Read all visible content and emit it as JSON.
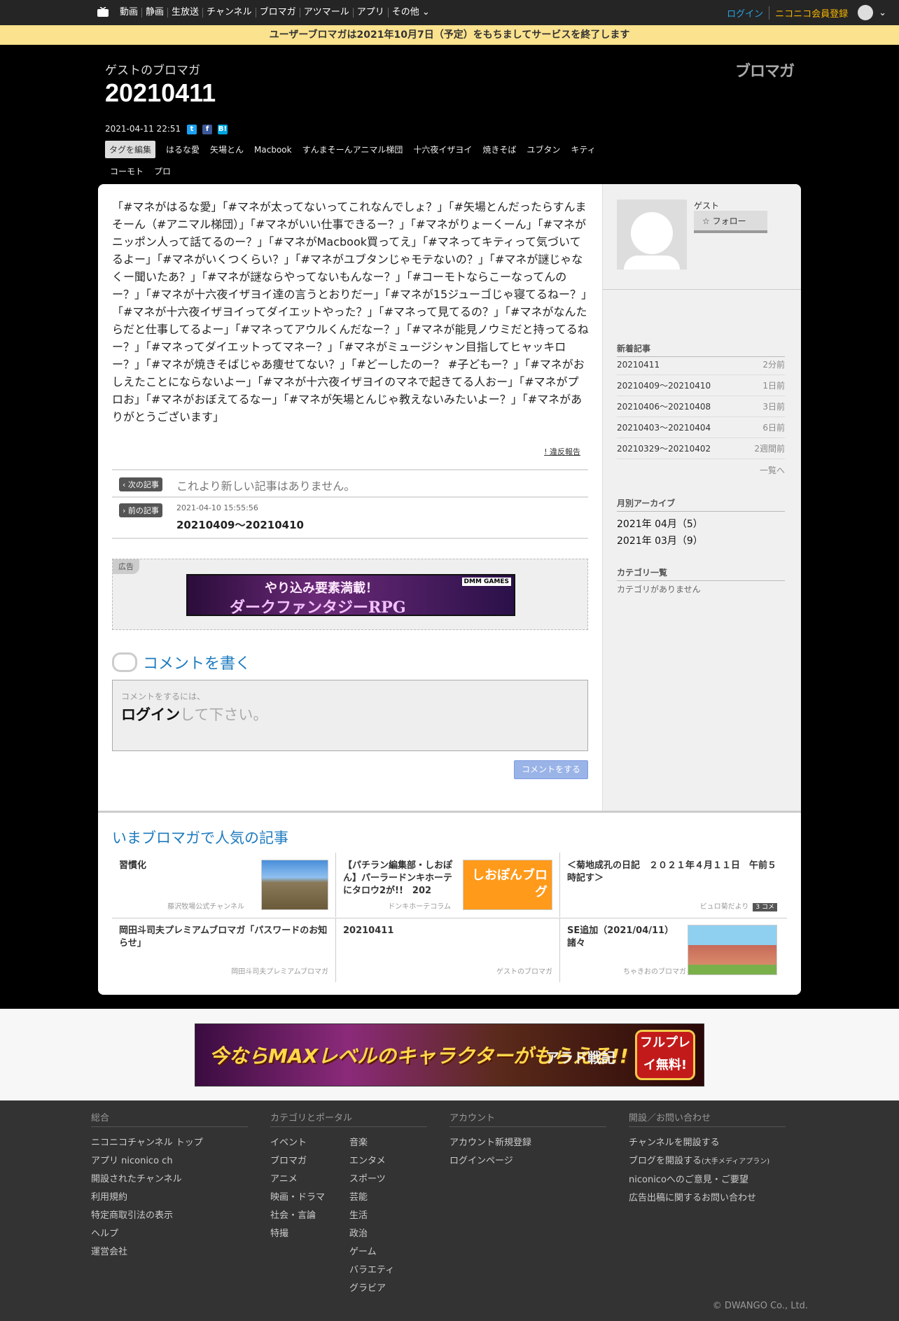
{
  "topbar": {
    "nav": [
      "動画",
      "静画",
      "生放送",
      "チャンネル",
      "ブロマガ",
      "アツマール",
      "アプリ",
      "その他"
    ],
    "login": "ログイン",
    "register": "ニコニコ会員登録"
  },
  "notice": "ユーザーブロマガは2021年10月7日（予定）をもちましてサービスを終了します",
  "header": {
    "blog_name": "ゲストのブロマガ",
    "title": "20210411",
    "brand": "ブロマガ",
    "date": "2021-04-11 22:51",
    "edit_tags": "タグを編集",
    "tags": [
      "はるな愛",
      "矢場とん",
      "Macbook",
      "すんまそーんアニマル梯団",
      "十六夜イザヨイ",
      "焼きそば",
      "ユブタン",
      "キティ",
      "コーモト",
      "プロ"
    ]
  },
  "article": {
    "body": "「#マネがはるな愛」「#マネが太ってないってこれなんでしょ？」「#矢場とんだったらすんまそーん（#アニマル梯団）」「#マネがいい仕事できるー？」「#マネがりょーくーん」「#マネがニッポン人って話てるのー？」「#マネがMacbook買ってえ」「#マネってキティって気づいてるよー」「#マネがいくつくらい？」「#マネがユブタンじゃモテないの？」「#マネが謎じゃなくー聞いたあ？」「#マネが謎ならやってないもんなー？」「#コーモトならこーなってんのー？」「#マネが十六夜イザヨイ達の言うとおりだー」「#マネが15ジューゴじゃ寝てるねー？」「#マネが十六夜イザヨイってダイエットやった？」「#マネって見てるの？」「#マネがなんたらだと仕事してるよー」「#マネってアウルくんだなー？」「#マネが能見ノウミだと持ってるねー？」「#マネってダイエットってマネー？」「#マネがミュージシャン目指してヒャッキロー？」「#マネが焼きそばじゃあ痩せてない？」「#どーしたのー？ #子どもー？」「#マネがおしえたことにならないよー」「#マネが十六夜イザヨイのマネで起きてる人おー」「#マネがプロお」「#マネがおぼえてるなー」「#マネが矢場とんじゃ教えないみたいよー？」「#マネがありがとうございます」",
    "report": "! 違反報告",
    "next_label": "次の記事",
    "next_text": "これより新しい記事はありません。",
    "prev_label": "前の記事",
    "prev_date": "2021-04-10 15:55:56",
    "prev_title": "20210409～20210410"
  },
  "ad": {
    "label": "広告",
    "text1": "やり込み要素満載！",
    "text2": "ダークファンタジーRPG",
    "tag": "DMM GAMES"
  },
  "comment": {
    "heading": "コメントを書く",
    "small": "コメントをするには、",
    "login": "ログイン",
    "rest": "して下さい。",
    "button": "コメントをする"
  },
  "sidebar": {
    "name": "ゲスト",
    "follow": "フォロー",
    "new_heading": "新着記事",
    "new_items": [
      {
        "title": "20210411",
        "ago": "2分前"
      },
      {
        "title": "20210409～20210410",
        "ago": "1日前"
      },
      {
        "title": "20210406～20210408",
        "ago": "3日前"
      },
      {
        "title": "20210403～20210404",
        "ago": "6日前"
      },
      {
        "title": "20210329～20210402",
        "ago": "2週間前"
      }
    ],
    "more": "一覧へ",
    "archive_heading": "月別アーカイブ",
    "archive": [
      "2021年 04月（5）",
      "2021年 03月（9）"
    ],
    "category_heading": "カテゴリ一覧",
    "category_none": "カテゴリがありません"
  },
  "popular": {
    "heading": "いまブロマガで人気の記事",
    "items": [
      {
        "title": "習慣化",
        "source": "藤沢牧場公式チャンネル"
      },
      {
        "title": "【パチラン編集部・しおぽん】パーラードンキホーテにタロウ2が!!　202",
        "source": "ドンキホーテコラム"
      },
      {
        "title": "＜菊地成孔の日記　２０２１年４月１１日　午前５時記す＞",
        "source": "ビュロ菊だより",
        "badge": "3 コメ"
      },
      {
        "title": "岡田斗司夫プレミアムブロマガ「パスワードのお知らせ」",
        "source": "岡田斗司夫プレミアムブロマガ"
      },
      {
        "title": "20210411",
        "source": "ゲストのブロマガ"
      },
      {
        "title": "SE追加（2021/04/11）諸々",
        "source": "ちゃきおのブロマガ"
      }
    ],
    "img2_text": "しおぽんブログ"
  },
  "banner": {
    "text1": "今ならMAXレベルのキャラクターがもらえる!!",
    "text2": "アラド戦記",
    "text3": "フルプレイ無料!"
  },
  "footer": {
    "col1": {
      "heading": "総合",
      "items": [
        "ニコニコチャンネル トップ",
        "アプリ niconico ch",
        "開設されたチャンネル",
        "利用規約",
        "特定商取引法の表示",
        "ヘルプ",
        "運営会社"
      ]
    },
    "col2": {
      "heading": "カテゴリとポータル",
      "left": [
        "イベント",
        "ブロマガ",
        "アニメ",
        "映画・ドラマ",
        "社会・言論",
        "特撮"
      ],
      "right": [
        "音楽",
        "エンタメ",
        "スポーツ",
        "芸能",
        "生活",
        "政治",
        "ゲーム",
        "バラエティ",
        "グラビア"
      ]
    },
    "col3": {
      "heading": "アカウント",
      "items": [
        "アカウント新規登録",
        "ログインページ"
      ]
    },
    "col4": {
      "heading": "開設／お問い合わせ",
      "items": [
        "チャンネルを開設する",
        "ブログを開設する",
        "niconicoへのご意見・ご要望",
        "広告出稿に関するお問い合わせ"
      ],
      "blog_suffix": "(大手メディアプラン)"
    },
    "copyright": "© DWANGO Co., Ltd."
  }
}
